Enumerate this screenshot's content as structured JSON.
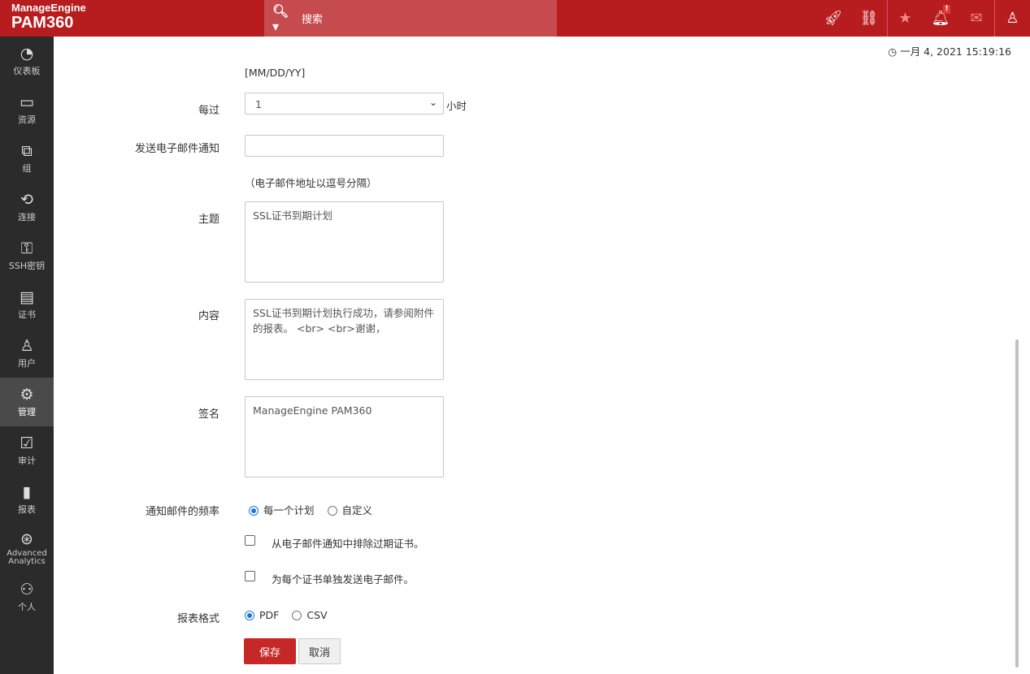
{
  "header": {
    "brand_top": "ManageEngine",
    "brand": "PAM360",
    "search_placeholder": "搜索",
    "notification_badge": "!"
  },
  "sidebar": [
    {
      "label": "仪表板",
      "icon": "dashboard-icon",
      "glyph": "◔"
    },
    {
      "label": "资源",
      "icon": "monitor-icon",
      "glyph": "▭"
    },
    {
      "label": "组",
      "icon": "group-icon",
      "glyph": "⧉"
    },
    {
      "label": "连接",
      "icon": "connection-icon",
      "glyph": "⟲"
    },
    {
      "label": "SSH密钥",
      "icon": "ssh-key-icon",
      "glyph": "⚿"
    },
    {
      "label": "证书",
      "icon": "certificate-icon",
      "glyph": "▤"
    },
    {
      "label": "用户",
      "icon": "user-icon",
      "glyph": "♙"
    },
    {
      "label": "管理",
      "icon": "gear-icon",
      "glyph": "⚙"
    },
    {
      "label": "审计",
      "icon": "clipboard-icon",
      "glyph": "☑"
    },
    {
      "label": "报表",
      "icon": "bar-chart-icon",
      "glyph": "▮"
    },
    {
      "label": "Advanced Analytics",
      "icon": "analytics-icon",
      "glyph": "⊛"
    },
    {
      "label": "个人",
      "icon": "personal-icon",
      "glyph": "⚇"
    }
  ],
  "datetime": "一月 4, 2021 15:19:16",
  "form": {
    "date_format": "[MM/DD/YY]",
    "every_label": "每过",
    "every_value": "1",
    "every_unit": "小时",
    "email_label": "发送电子邮件通知",
    "email_value": "",
    "email_hint": "（电子邮件地址以逗号分隔）",
    "subject_label": "主题",
    "subject_value": "SSL证书到期计划",
    "content_label": "内容",
    "content_value": "SSL证书到期计划执行成功，请参阅附件的报表。 <br> <br>谢谢，",
    "signature_label": "签名",
    "signature_value": "ManageEngine PAM360",
    "frequency_label": "通知邮件的频率",
    "freq_options": [
      "每一个计划",
      "自定义"
    ],
    "exclude_expired": "从电子邮件通知中排除过期证书。",
    "separate_email": "为每个证书单独发送电子邮件。",
    "format_label": "报表格式",
    "format_options": [
      "PDF",
      "CSV"
    ],
    "save": "保存",
    "cancel": "取消"
  }
}
